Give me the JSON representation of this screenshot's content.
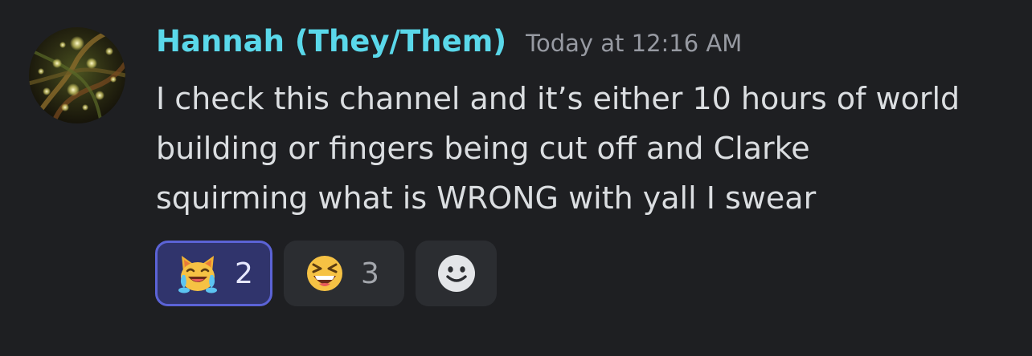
{
  "message": {
    "author": "Hannah (They/Them)",
    "timestamp": "Today at 12:16 AM",
    "lines": [
      "I check this channel and it’s either 10 hours of world",
      "building or fingers being cut off and Clarke",
      "squirming what is WRONG with yall I swear"
    ]
  },
  "reactions": [
    {
      "emoji": "cat-face-with-tears-of-joy-icon",
      "count": "2",
      "active": true
    },
    {
      "emoji": "grinning-squinting-face-icon",
      "count": "3",
      "active": false
    }
  ],
  "add_reaction": {
    "icon": "smiley-add-reaction-icon"
  },
  "colors": {
    "background": "#1e1f22",
    "username": "#5ad8ea",
    "timestamp": "#979aa2",
    "text": "#dbdee1",
    "reaction_bg": "#2b2d31",
    "reaction_active_bg": "#30346c",
    "reaction_active_border": "#5b63d6"
  }
}
